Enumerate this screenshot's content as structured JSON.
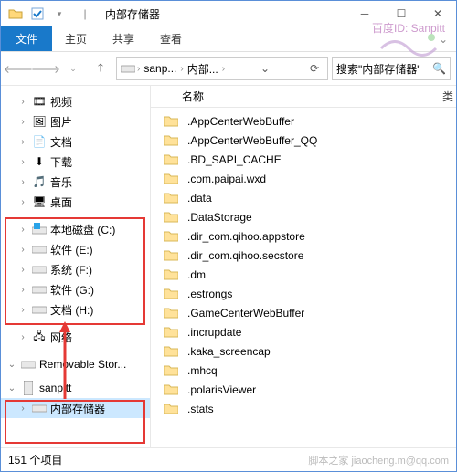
{
  "window": {
    "title": "内部存储器",
    "sep": "|"
  },
  "ribbon": {
    "file": "文件",
    "tabs": [
      "主页",
      "共享",
      "查看"
    ]
  },
  "address": {
    "crumbs": [
      "sanp...",
      "内部..."
    ]
  },
  "search": {
    "placeholder": "搜索\"内部存储器\""
  },
  "nav": {
    "items": [
      {
        "label": "视频",
        "icon": "video"
      },
      {
        "label": "图片",
        "icon": "pic"
      },
      {
        "label": "文档",
        "icon": "doc"
      },
      {
        "label": "下载",
        "icon": "download"
      },
      {
        "label": "音乐",
        "icon": "music"
      },
      {
        "label": "桌面",
        "icon": "desktop"
      }
    ],
    "drives": [
      {
        "label": "本地磁盘 (C:)",
        "icon": "drive-win"
      },
      {
        "label": "软件 (E:)",
        "icon": "drive"
      },
      {
        "label": "系统 (F:)",
        "icon": "drive"
      },
      {
        "label": "软件 (G:)",
        "icon": "drive"
      },
      {
        "label": "文档 (H:)",
        "icon": "drive"
      }
    ],
    "network": {
      "label": "网络"
    },
    "removable": {
      "label": "Removable Stor..."
    },
    "device": {
      "label": "sanpitt",
      "child": "内部存储器"
    }
  },
  "columns": {
    "name": "名称",
    "more": "类"
  },
  "files": [
    ".AppCenterWebBuffer",
    ".AppCenterWebBuffer_QQ",
    ".BD_SAPI_CACHE",
    ".com.paipai.wxd",
    ".data",
    ".DataStorage",
    ".dir_com.qihoo.appstore",
    ".dir_com.qihoo.secstore",
    ".dm",
    ".estrongs",
    ".GameCenterWebBuffer",
    ".incrupdate",
    ".kaka_screencap",
    ".mhcq",
    ".polarisViewer",
    ".stats"
  ],
  "status": {
    "count": "151 个项目"
  },
  "watermark": {
    "line1": "百度ID: Sanpitt",
    "footer": "脚本之家 jiaocheng.m@qq.com"
  }
}
